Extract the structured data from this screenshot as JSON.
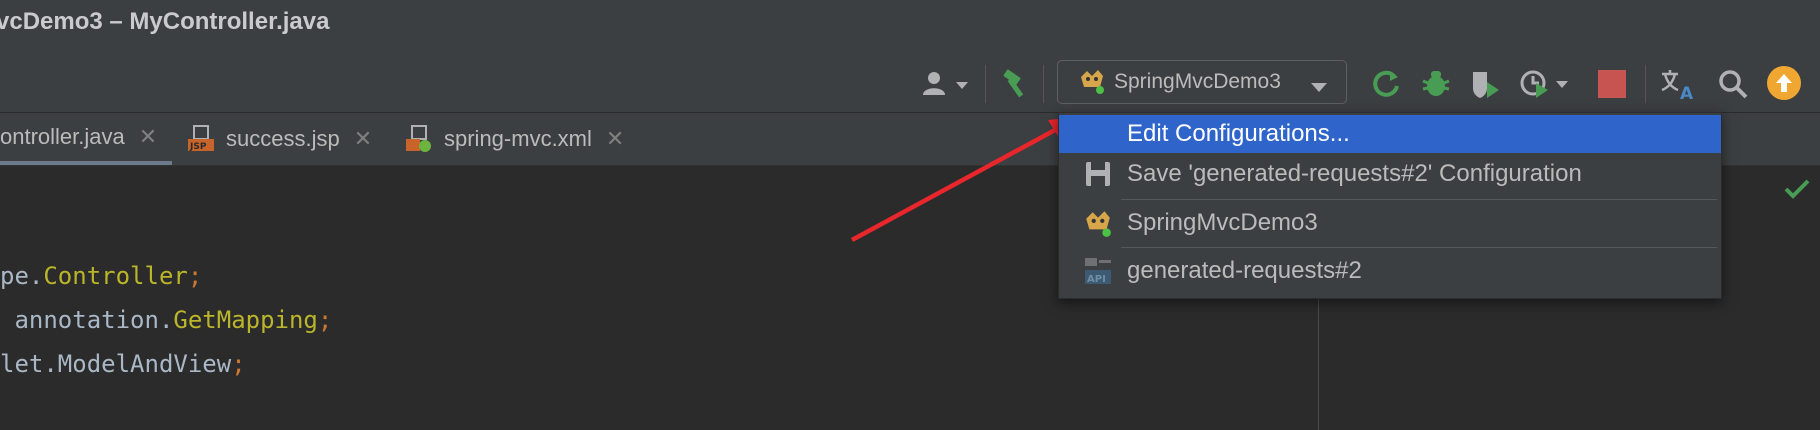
{
  "window": {
    "title": "vcDemo3 – MyController.java"
  },
  "toolbar": {
    "run_config": "SpringMvcDemo3",
    "icons": [
      "user-icon",
      "hammer-icon",
      "rerun-icon",
      "debug-icon",
      "coverage-icon",
      "profile-icon",
      "stop-icon",
      "translate-icon",
      "search-icon",
      "update-icon"
    ]
  },
  "tabs": [
    {
      "label": "ontroller.java",
      "active": true
    },
    {
      "label": "success.jsp",
      "active": false
    },
    {
      "label": "spring-mvc.xml",
      "active": false
    }
  ],
  "code": [
    {
      "pre": "pe.",
      "cls": "Controller",
      "semi": ";"
    },
    {
      "pre": " annotation.",
      "cls": "GetMapping",
      "semi": ";"
    },
    {
      "pre": "let.ModelAndView",
      "cls": "",
      "semi": ";"
    }
  ],
  "dropdown": {
    "items": [
      {
        "label": "Edit Configurations...",
        "selected": true
      },
      {
        "label": "Save 'generated-requests#2' Configuration",
        "icon": "save-icon"
      },
      {
        "label": "SpringMvcDemo3",
        "icon": "tomcat-icon"
      },
      {
        "label": "generated-requests#2",
        "icon": "api-icon"
      }
    ]
  },
  "colors": {
    "accent": "#2f65ca",
    "arrow": "#e8262c",
    "green": "#499c54",
    "stop": "#c75450",
    "update": "#f0a732"
  }
}
